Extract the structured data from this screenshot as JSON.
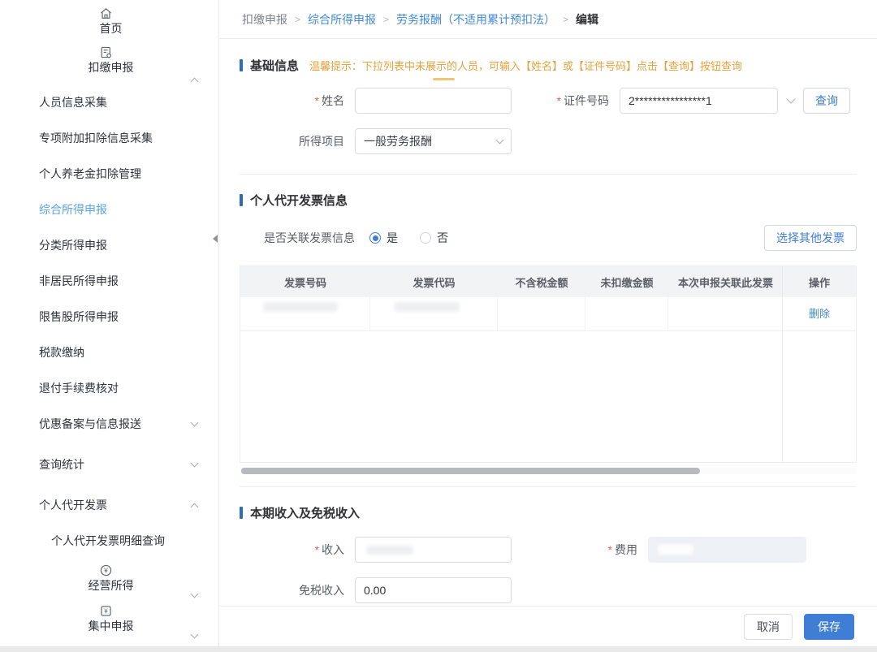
{
  "ui": {
    "required_mark": "*",
    "breadcrumb_separator": ">"
  },
  "colors": {
    "accent": "#3f7ed3",
    "warning_text": "#e6a23c",
    "sidebar_active": "#5ca3e6",
    "save_button_bg": "#3f7ed4",
    "delete_link": "#4289d8"
  },
  "breadcrumb": {
    "items": [
      "扣缴申报",
      "综合所得申报",
      "劳务报酬（不适用累计预扣法）",
      "编辑"
    ]
  },
  "sidebar": {
    "home": "首页",
    "withholding": "扣缴申报",
    "sub": [
      "人员信息采集",
      "专项附加扣除信息采集",
      "个人养老金扣除管理",
      "综合所得申报",
      "分类所得申报",
      "非居民所得申报",
      "限售股所得申报",
      "税款缴纳",
      "退付手续费核对",
      "优惠备案与信息报送",
      "查询统计",
      "个人代开发票"
    ],
    "invoice_detail_query": "个人代开发票明细查询",
    "business_income": "经营所得",
    "centralized_declaration": "集中申报"
  },
  "basic_info": {
    "title": "基础信息",
    "tip": "温馨提示：下拉列表中未展示的人员，可输入【姓名】或【证件号码】点击【查询】按钮查询",
    "name_label": "姓名",
    "name_value": "",
    "id_label": "证件号码",
    "id_value": "2****************1",
    "query_button": "查询",
    "income_item_label": "所得项目",
    "income_item_value": "一般劳务报酬"
  },
  "invoice_info": {
    "title": "个人代开发票信息",
    "link_question_label": "是否关联发票信息",
    "radio_yes": "是",
    "radio_no": "否",
    "select_other_button": "选择其他发票",
    "table": {
      "columns": [
        "发票号码",
        "发票代码",
        "不含税金额",
        "未扣缴金额",
        "本次申报关联此发票",
        "操作"
      ],
      "rows": [
        {
          "invoice_no": "",
          "invoice_code": "",
          "amount_ex_tax": "",
          "unwithheld_amount": "",
          "linked_this_filing": "",
          "action": "删除"
        }
      ]
    }
  },
  "income_section": {
    "title": "本期收入及免税收入",
    "income_label": "收入",
    "income_value": "",
    "fee_label": "费用",
    "fee_value": "",
    "tax_free_label": "免税收入",
    "tax_free_value": "0.00"
  },
  "footer": {
    "cancel_button": "取消",
    "save_button": "保存"
  }
}
